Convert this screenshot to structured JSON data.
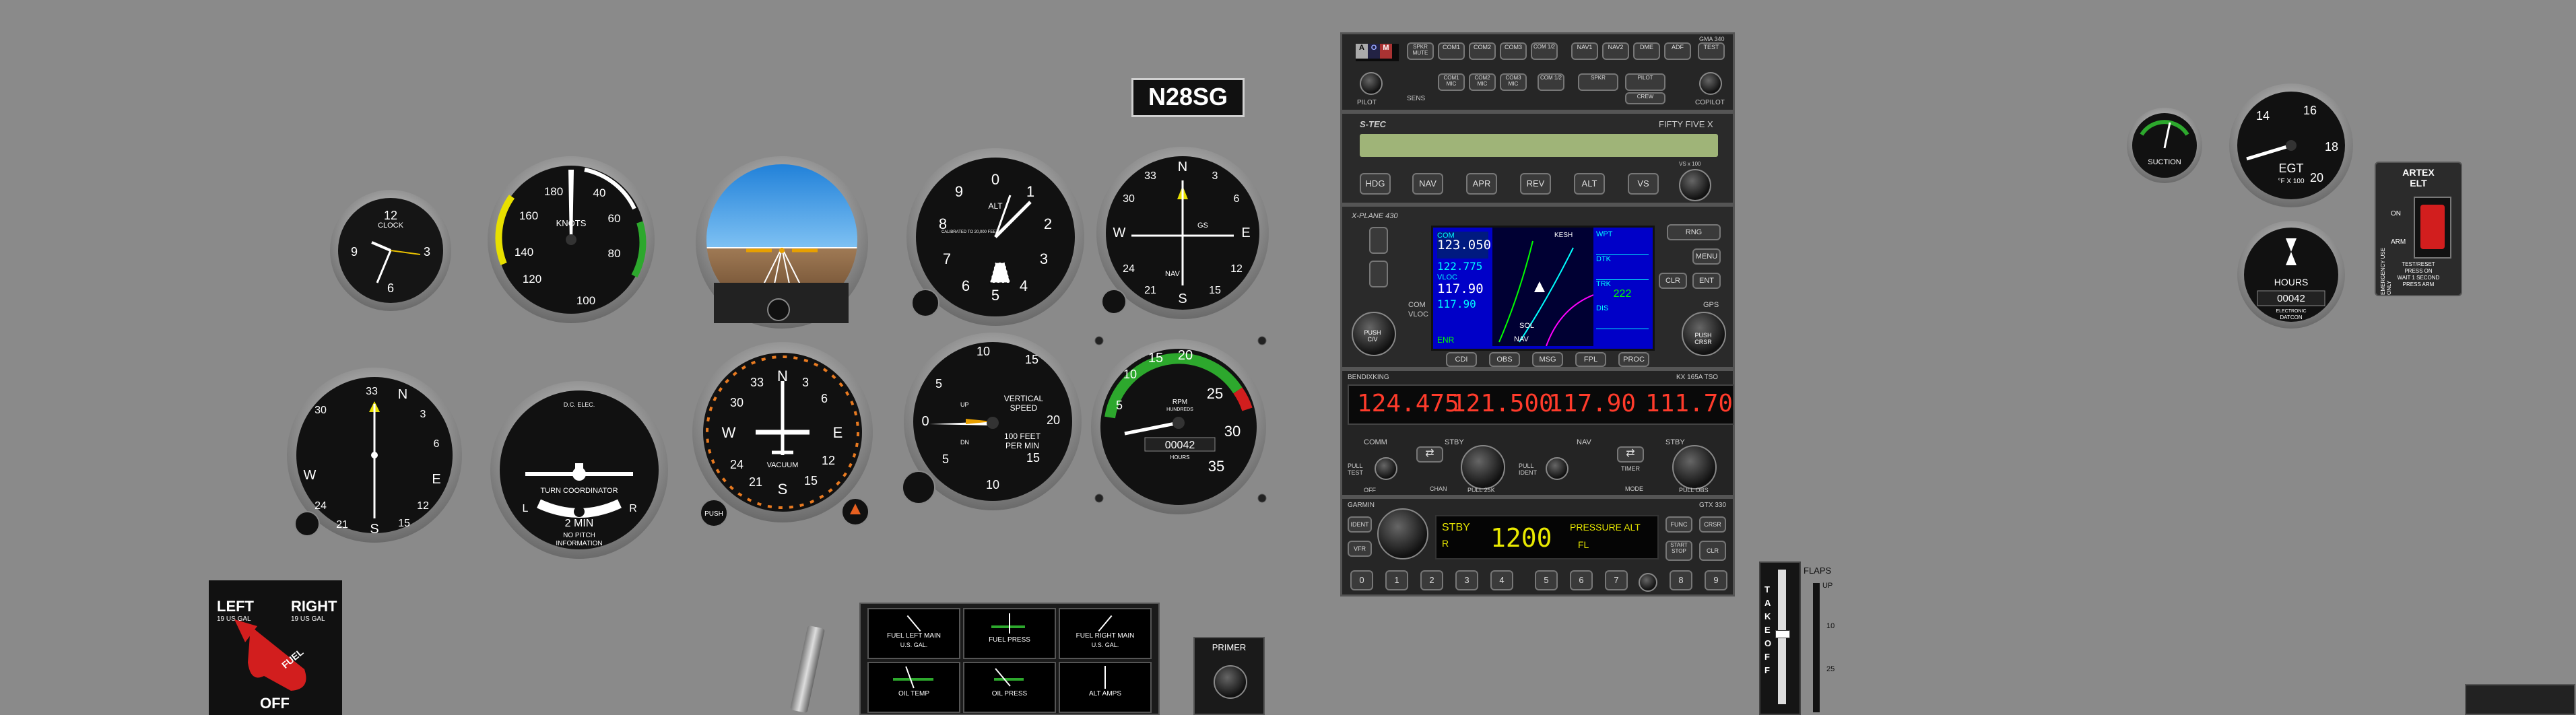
{
  "tail_number": "N28SG",
  "clock": {
    "label": "CLOCK",
    "numerals": [
      "12",
      "3",
      "6",
      "9"
    ]
  },
  "airspeed": {
    "label": "KNOTS",
    "numerals": [
      "180",
      "160",
      "140",
      "120",
      "100",
      "40",
      "60",
      "80"
    ]
  },
  "altimeter": {
    "label": "ALT",
    "sub": "CALIBRATED TO 20,000 FEET",
    "numerals": [
      "0",
      "1",
      "2",
      "3",
      "4",
      "5",
      "6",
      "7",
      "8",
      "9"
    ]
  },
  "nav1": {
    "label": "GS",
    "sub": "NAV",
    "numerals": [
      "N",
      "3",
      "6",
      "E",
      "12",
      "15",
      "S",
      "21",
      "24",
      "W",
      "30",
      "33"
    ]
  },
  "adf_heading": {
    "numerals": [
      "33",
      "N",
      "3",
      "6",
      "E",
      "12",
      "15",
      "S",
      "21",
      "24",
      "W",
      "30"
    ]
  },
  "turn_coordinator": {
    "top": "D.C. ELEC.",
    "title": "TURN COORDINATOR",
    "min": "2 MIN",
    "bottom1": "NO PITCH",
    "bottom2": "INFORMATION",
    "left": "L",
    "right": "R"
  },
  "heading_indicator": {
    "label": "VACUUM",
    "push": "PUSH",
    "numerals": [
      "N",
      "3",
      "6",
      "E",
      "12",
      "15",
      "S",
      "21",
      "24",
      "W",
      "30",
      "33"
    ]
  },
  "vsi": {
    "line1": "VERTICAL",
    "line2": "SPEED",
    "line3": "100 FEET",
    "line4": "PER MIN",
    "up": "UP",
    "down": "DN",
    "numerals": [
      "0",
      "5",
      "10",
      "15",
      "20",
      "15",
      "10",
      "5"
    ]
  },
  "tach": {
    "label": "RPM",
    "sub": "HUNDREDS",
    "hours_label": "HOURS",
    "hobbs": "00042",
    "numerals": [
      "5",
      "10",
      "15",
      "20",
      "25",
      "30",
      "35"
    ]
  },
  "audio_panel": {
    "top_buttons": [
      "SPKR MUTE",
      "COM1",
      "COM2",
      "COM3",
      "COM 1/2",
      "NAV1",
      "NAV2",
      "DME",
      "ADF",
      "TEST"
    ],
    "bottom_buttons": [
      "COM1 MIC",
      "COM2 MIC",
      "COM3 MIC",
      "COM 1/2",
      "SPKR",
      "PILOT",
      "CREW"
    ],
    "pilot": "PILOT",
    "copilot": "COPILOT",
    "model": "GMA 340",
    "mkr": [
      "A",
      "O",
      "M"
    ],
    "sens": "SENS"
  },
  "autopilot": {
    "brand": "S-TEC",
    "model": "FIFTY FIVE X",
    "buttons": [
      "HDG",
      "NAV",
      "APR",
      "REV",
      "ALT",
      "VS"
    ],
    "vs_label": "VS x 100"
  },
  "gps430": {
    "brand": "X-PLANE 430",
    "com_active": "123.050",
    "com_standby": "122.775",
    "vloc_active": "117.90",
    "vloc_standby": "117.90",
    "right_labels": [
      "WPT",
      "DTK",
      "TRK",
      "DIS"
    ],
    "right_values": [
      "",
      "",
      "222",
      ""
    ],
    "map_label": "KESH",
    "sol_label": "SOL",
    "enr": "ENR",
    "vloc": "VLOC",
    "nav": "NAV",
    "bottom_buttons": [
      "CDI",
      "OBS",
      "MSG",
      "FPL",
      "PROC"
    ],
    "side_buttons": [
      "RNG",
      "MENU",
      "CLR",
      "ENT"
    ],
    "left_labels": [
      "COM",
      "VLOC",
      "PUSH C/V"
    ],
    "right_knob": "PUSH CRSR",
    "gps_label": "GPS"
  },
  "kx165": {
    "brand": "BENDIXKING",
    "model": "KX 165A TSO",
    "com_active": "124.475",
    "com_standby": "121.500",
    "nav_active": "117.90",
    "nav_standby": "111.70",
    "comm": "COMM",
    "stby": "STBY",
    "nav": "NAV",
    "pull_test": "PULL TEST",
    "off": "OFF",
    "chan": "CHAN",
    "pull_25k": "PULL 25K",
    "pull_ident": "PULL IDENT",
    "timer": "TIMER",
    "mode": "MODE",
    "pull_obs": "PULL OBS"
  },
  "transponder": {
    "brand": "GARMIN",
    "model": "GTX 330",
    "mode": "STBY",
    "code": "1200",
    "pressure_alt": "PRESSURE ALT",
    "fl": "FL",
    "r": "R",
    "side_buttons": [
      "IDENT",
      "VFR"
    ],
    "right_buttons": [
      "FUNC",
      "CRSR",
      "START STOP",
      "CLR"
    ],
    "digits": [
      "0",
      "1",
      "2",
      "3",
      "4",
      "5",
      "6",
      "7",
      "8",
      "9"
    ]
  },
  "fuel_selector": {
    "left": "LEFT",
    "left_sub": "19 US GAL",
    "right": "RIGHT",
    "right_sub": "19 US GAL",
    "fuel": "FUEL",
    "off": "OFF"
  },
  "engine_gauges": [
    {
      "label": "FUEL LEFT MAIN",
      "sub": "U.S. GAL."
    },
    {
      "label": "FUEL PRESS",
      "sub": ""
    },
    {
      "label": "FUEL RIGHT MAIN",
      "sub": "U.S. GAL."
    },
    {
      "label": "OIL TEMP",
      "sub": ""
    },
    {
      "label": "OIL PRESS",
      "sub": ""
    },
    {
      "label": "ALT AMPS",
      "sub": ""
    }
  ],
  "primer": {
    "label": "PRIMER"
  },
  "flaps": {
    "label": "FLAPS",
    "takeoff": "TAKE OFF",
    "up": "UP",
    "ten": "10",
    "twentyfive": "25"
  },
  "suction": {
    "label": "SUCTION"
  },
  "egt": {
    "label": "EGT",
    "sub": "°F X 100",
    "numerals": [
      "14",
      "16",
      "18",
      "20"
    ]
  },
  "hobbs": {
    "label": "HOURS",
    "digits": "00042",
    "brand": "DATCON",
    "sub": "ELECTRONIC"
  },
  "elt": {
    "brand": "ARTEX",
    "label": "ELT",
    "on": "ON",
    "arm": "ARM",
    "side": "EMERGENCY USE ONLY",
    "note1": "TEST/RESET",
    "note2": "PRESS ON",
    "note3": "WAIT 1 SECOND",
    "note4": "PRESS ARM"
  },
  "colors": {
    "panel": "#8a8a8a",
    "gauge_face": "#111111",
    "lcd_green": "#9fb478",
    "red_display": "#ff3b2b",
    "gps_screen": "#0000cc",
    "transponder_text": "#e8e800",
    "elt_switch": "#d21e1e"
  }
}
